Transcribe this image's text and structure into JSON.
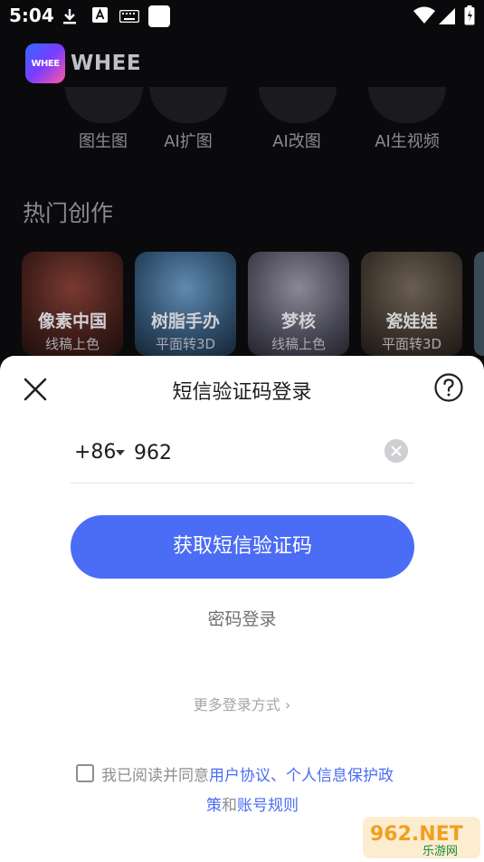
{
  "status_bar": {
    "time": "5:04",
    "icons": [
      "download-icon",
      "font-icon",
      "keyboard-icon",
      "white-square-icon",
      "wifi-icon",
      "signal-icon",
      "battery-icon"
    ]
  },
  "app": {
    "logo_text": "WHEE",
    "name": "WHEE"
  },
  "tools": [
    "图生图",
    "AI扩图",
    "AI改图",
    "AI生视频"
  ],
  "section": {
    "title": "热门创作"
  },
  "cards": [
    {
      "title": "像素中国",
      "subtitle": "线稿上色",
      "color": "#5a2a24"
    },
    {
      "title": "树脂手办",
      "subtitle": "平面转3D",
      "color": "#3c5a7a"
    },
    {
      "title": "梦核",
      "subtitle": "线稿上色",
      "color": "#4a4a55"
    },
    {
      "title": "瓷娃娃",
      "subtitle": "平面转3D",
      "color": "#3a3530"
    }
  ],
  "sheet": {
    "title": "短信验证码登录",
    "country_code": "+86",
    "phone_value": "962",
    "primary_button": "获取短信验证码",
    "password_login": "密码登录",
    "more_login": "更多登录方式 ›",
    "agreement": {
      "prefix": "我已阅读并同意",
      "link1": "用户协议、个人信息保护政",
      "link1_cont": "策",
      "conj": "和",
      "link2": "账号规则"
    }
  },
  "watermark": {
    "brand": "962.NET",
    "sub": "乐游网"
  },
  "colors": {
    "accent": "#4b6cf5",
    "sheet_bg": "#ffffff",
    "page_bg": "#0a0a0c"
  }
}
